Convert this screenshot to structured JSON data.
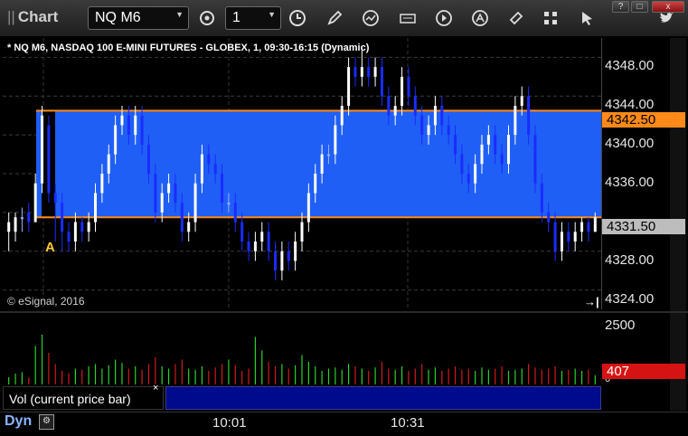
{
  "window": {
    "title": "Chart",
    "minimize": "?",
    "maximize": "□",
    "close": "x"
  },
  "toolbar": {
    "symbol": "NQ M6",
    "interval": "1"
  },
  "chart": {
    "info": "* NQ M6, NASDAQ 100 E-MINI FUTURES - GLOBEX, 1, 09:30-16:15 (Dynamic)",
    "copyright": "© eSignal, 2016",
    "marker_label": "A",
    "range": {
      "high": 4342.5,
      "low": 4331.5,
      "fill_color": "#1f5ff5",
      "line_color": "#ff8a1a"
    },
    "price_ticks": [
      "4348.00",
      "4344.00",
      "4340.00",
      "4336.00",
      "4328.00",
      "4324.00"
    ],
    "high_label": "4342.50",
    "low_label": "4331.50",
    "volume_ticks": [
      "2500",
      "0"
    ],
    "volume_label": "407",
    "legend": "Vol (current price bar)",
    "legend_close": "×",
    "time_labels": [
      "10:01",
      "10:31"
    ],
    "dyn_label": "Dyn",
    "colors": {
      "up": "#ffffff",
      "down": "#1a2cff",
      "doji": "#9db0ff",
      "vol_up": "#2bd12b",
      "vol_down": "#d21a1a"
    }
  },
  "chart_data": {
    "type": "candlestick",
    "y_range": [
      4322,
      4350
    ],
    "bars": [
      [
        4330,
        4331,
        4328,
        4332
      ],
      [
        4330,
        4331.5,
        4329,
        4332
      ],
      [
        4331.5,
        4331.5,
        4330,
        4332.5
      ],
      [
        4332,
        4331,
        4330,
        4333
      ],
      [
        4331,
        4335,
        4331,
        4336
      ],
      [
        4335,
        4342,
        4334,
        4343
      ],
      [
        4341,
        4334,
        4333,
        4342
      ],
      [
        4334,
        4333,
        4329,
        4335
      ],
      [
        4333,
        4330,
        4328,
        4334
      ],
      [
        4330,
        4329,
        4328,
        4331
      ],
      [
        4329,
        4331,
        4328,
        4332
      ],
      [
        4331,
        4330,
        4329,
        4331.5
      ],
      [
        4330,
        4331,
        4329,
        4332
      ],
      [
        4331,
        4334,
        4330,
        4335
      ],
      [
        4334,
        4336,
        4333,
        4337
      ],
      [
        4336,
        4338,
        4335,
        4339
      ],
      [
        4338,
        4341,
        4337,
        4342
      ],
      [
        4341,
        4342,
        4340,
        4343
      ],
      [
        4342,
        4340,
        4339,
        4343
      ],
      [
        4340,
        4342,
        4339,
        4343
      ],
      [
        4342,
        4339,
        4338,
        4343
      ],
      [
        4339,
        4336,
        4335,
        4340
      ],
      [
        4336,
        4332,
        4331,
        4337
      ],
      [
        4332,
        4334,
        4331,
        4335
      ],
      [
        4334,
        4335,
        4333,
        4336
      ],
      [
        4335,
        4333,
        4332,
        4336
      ],
      [
        4333,
        4330,
        4329,
        4334
      ],
      [
        4330,
        4331,
        4329,
        4332
      ],
      [
        4331,
        4335,
        4330,
        4336
      ],
      [
        4335,
        4338,
        4334,
        4339
      ],
      [
        4338,
        4337,
        4336,
        4339
      ],
      [
        4337,
        4336,
        4335,
        4338
      ],
      [
        4336,
        4333,
        4332,
        4337
      ],
      [
        4333,
        4333,
        4332,
        4334
      ],
      [
        4333,
        4331,
        4330,
        4334
      ],
      [
        4331,
        4329,
        4328,
        4332
      ],
      [
        4329,
        4328,
        4327,
        4330
      ],
      [
        4328,
        4329,
        4327,
        4330
      ],
      [
        4329,
        4330,
        4328,
        4331
      ],
      [
        4330,
        4328,
        4327,
        4331
      ],
      [
        4328,
        4326,
        4325,
        4329
      ],
      [
        4326,
        4328,
        4325,
        4329
      ],
      [
        4328,
        4327,
        4326,
        4329
      ],
      [
        4327,
        4329,
        4326,
        4330
      ],
      [
        4329,
        4331,
        4328,
        4332
      ],
      [
        4331,
        4334,
        4330,
        4335
      ],
      [
        4334,
        4336,
        4333,
        4337
      ],
      [
        4336,
        4338,
        4335,
        4339
      ],
      [
        4338,
        4338,
        4337,
        4339
      ],
      [
        4338,
        4341,
        4337,
        4342
      ],
      [
        4341,
        4343,
        4340,
        4344
      ],
      [
        4343,
        4347,
        4342,
        4348
      ],
      [
        4347,
        4346,
        4345,
        4348
      ],
      [
        4346,
        4347,
        4345,
        4349
      ],
      [
        4347,
        4346,
        4345,
        4348
      ],
      [
        4346,
        4347,
        4345,
        4348
      ],
      [
        4347,
        4344,
        4343,
        4348
      ],
      [
        4344,
        4342,
        4341,
        4345
      ],
      [
        4342,
        4343,
        4341,
        4344
      ],
      [
        4343,
        4346,
        4342,
        4347
      ],
      [
        4346,
        4344,
        4343,
        4347
      ],
      [
        4344,
        4342,
        4341,
        4345
      ],
      [
        4342,
        4340,
        4339,
        4343
      ],
      [
        4340,
        4341,
        4339,
        4342
      ],
      [
        4341,
        4343,
        4340,
        4344
      ],
      [
        4343,
        4341,
        4340,
        4344
      ],
      [
        4341,
        4340,
        4339,
        4342
      ],
      [
        4340,
        4338,
        4337,
        4341
      ],
      [
        4338,
        4336,
        4335,
        4339
      ],
      [
        4336,
        4335,
        4334,
        4337
      ],
      [
        4335,
        4337,
        4334,
        4338
      ],
      [
        4337,
        4339,
        4336,
        4340
      ],
      [
        4339,
        4340,
        4338,
        4341
      ],
      [
        4340,
        4338,
        4337,
        4341
      ],
      [
        4338,
        4337,
        4336,
        4339
      ],
      [
        4337,
        4340,
        4336,
        4341
      ],
      [
        4340,
        4343,
        4339,
        4344
      ],
      [
        4343,
        4344,
        4342,
        4345
      ],
      [
        4344,
        4340,
        4339,
        4345
      ],
      [
        4340,
        4335,
        4334,
        4341
      ],
      [
        4335,
        4332,
        4331,
        4336
      ],
      [
        4332,
        4331,
        4330,
        4333
      ],
      [
        4331,
        4328,
        4327,
        4332
      ],
      [
        4328,
        4330,
        4327,
        4331
      ],
      [
        4330,
        4329,
        4328,
        4331
      ],
      [
        4329,
        4330,
        4328,
        4331
      ],
      [
        4330,
        4331,
        4329,
        4331.5
      ],
      [
        4331,
        4330,
        4329,
        4331.5
      ],
      [
        4330,
        4331.5,
        4330,
        4332
      ]
    ],
    "volume": [
      320,
      480,
      540,
      300,
      1700,
      2200,
      1400,
      900,
      600,
      500,
      700,
      650,
      800,
      900,
      700,
      850,
      1100,
      950,
      700,
      800,
      650,
      900,
      1200,
      800,
      700,
      900,
      1100,
      700,
      650,
      800,
      600,
      750,
      900,
      1100,
      850,
      600,
      700,
      2100,
      1500,
      1000,
      800,
      900,
      700,
      850,
      1300,
      1000,
      800,
      600,
      700,
      750,
      650,
      900,
      800,
      700,
      600,
      750,
      1000,
      700,
      650,
      800,
      600,
      700,
      900,
      650,
      750,
      600,
      700,
      800,
      650,
      700,
      600,
      750,
      650,
      700,
      800,
      600,
      650,
      700,
      900,
      750,
      650,
      700,
      800,
      600,
      650,
      700,
      600,
      650,
      407
    ],
    "volume_range": [
      0,
      3000
    ]
  }
}
